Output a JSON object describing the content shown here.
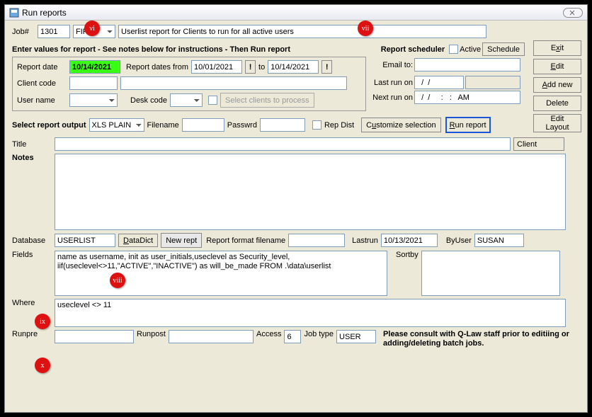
{
  "window": {
    "title": "Run reports"
  },
  "job": {
    "label": "Job#",
    "number": "1301",
    "firm": "FIRM",
    "desc": "Userlist report for Clients to run for all active users"
  },
  "instructions": "Enter values for report - See notes below for instructions - Then Run report",
  "section": {
    "report_date_lbl": "Report date",
    "report_date": "10/14/2021",
    "dates_from_lbl": "Report dates from",
    "date_from": "10/01/2021",
    "to_lbl": "to",
    "date_to": "10/14/2021",
    "client_code_lbl": "Client code",
    "client_code": "",
    "client_code2": "",
    "user_name_lbl": "User name",
    "user_name": "",
    "desk_code_lbl": "Desk code",
    "desk_code": "",
    "select_clients_lbl": "Select clients to process"
  },
  "scheduler": {
    "title": "Report scheduler",
    "active_lbl": "Active",
    "schedule_btn": "Schedule",
    "email_lbl": "Email to:",
    "email": "",
    "last_lbl": "Last run on",
    "last": "  /  /",
    "next_lbl": "Next run on",
    "next": "  /  /     :   :   AM"
  },
  "sidebar": {
    "exit": "Exit",
    "edit": "Edit",
    "addnew": "Add new",
    "delete": "Delete",
    "editlayout": "Edit Layout"
  },
  "output": {
    "select_lbl": "Select report output",
    "type": "XLS PLAIN",
    "filename_lbl": "Filename",
    "filename": "",
    "passwrd_lbl": "Passwrd",
    "passwrd": "",
    "rep_dist_lbl": "Rep Dist",
    "customize_btn": "Customize selection",
    "run_btn": "Run report"
  },
  "meta": {
    "title_lbl": "Title",
    "title": "",
    "client_btn": "Client",
    "notes_lbl": "Notes",
    "notes": "",
    "database_lbl": "Database",
    "database": "USERLIST",
    "datadict_btn": "DataDict",
    "newrept_btn": "New rept",
    "format_lbl": "Report format filename",
    "format": "",
    "lastrun_lbl": "Lastrun",
    "lastrun": "10/13/2021",
    "byuser_lbl": "ByUser",
    "byuser": "SUSAN",
    "fields_lbl": "Fields",
    "fields": "name as username, init as user_initials,useclevel as Security_level, iif(useclevel<>11,\"ACTIVE\",\"INACTIVE\") as will_be_made FROM .\\data\\userlist",
    "sortby_lbl": "Sortby",
    "sortby": "",
    "where_lbl": "Where",
    "where": "useclevel <> 11",
    "runpre_lbl": "Runpre",
    "runpre": "",
    "runpost_lbl": "Runpost",
    "runpost": "",
    "access_lbl": "Access",
    "access": "6",
    "jobtype_lbl": "Job type",
    "jobtype": "USER",
    "warning": "Please consult with Q-Law staff prior to editiing or adding/deleting batch jobs."
  },
  "markers": {
    "vi": "vi",
    "vii": "vii",
    "viii": "viii",
    "ix": "ix",
    "x": "x"
  }
}
